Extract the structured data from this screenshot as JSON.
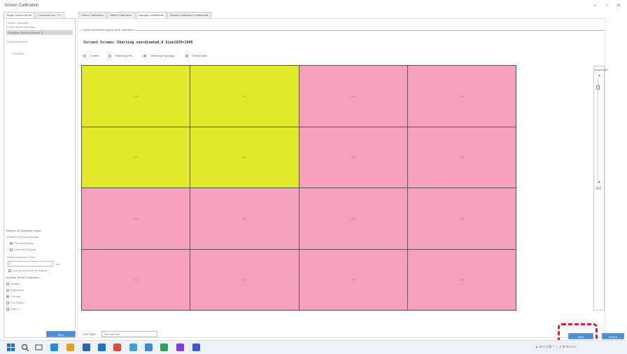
{
  "window": {
    "title": "Screen Calibration",
    "min": "–",
    "max": "▫",
    "close": "×"
  },
  "tabs_left": [
    "Single Screen Mode",
    "Combined Inc. T.C."
  ],
  "tabs_right": [
    "Online Calibration",
    "Offline Calibration",
    "Manage Coefficients",
    "Reload Calibration Coefficients"
  ],
  "left_panel": {
    "screen_section": "Current Operation",
    "sub_label": "Screen Mode Selection",
    "screen_item": "Configure Screen (Screen 1)",
    "receiver_label": "Current Receiver",
    "tree_item": "+ Screen1",
    "settings_title": "Settings of Displaying Image",
    "position_label": "Position to Display Image:",
    "opt_primary": "Primary Display",
    "opt_extended": "Extended Display",
    "delay_label": "Select Response Time:",
    "delay_value": "0",
    "delay_unit": "ms",
    "use_input": "Use input source for display",
    "gradient_title": "Gradient Border Calibration",
    "opt_disable": "Disable",
    "opt_brightness": "Brightness",
    "opt_chroma": "Chroma",
    "full_output": "Full Output",
    "data_in": "Data In"
  },
  "main": {
    "group_label": "Select coefficient regions to be operated",
    "info": "Current Screen: Starting coordinate0,0  Size1920×1080",
    "opt_screen": "Screen",
    "opt_file": "Select by File...",
    "opt_topology": "Select by Topology...",
    "opt_all": "Select Area",
    "cells": [
      "1-1",
      "1-2",
      "1-3",
      "1-4",
      "2-1",
      "2-2",
      "2-3",
      "2-4",
      "3-1",
      "3-2",
      "3-3",
      "3-4",
      "4-1",
      "4-2",
      "4-3",
      "4-4"
    ],
    "cell_types": [
      "y",
      "y",
      "p",
      "p",
      "y",
      "y",
      "p",
      "p",
      "p",
      "p",
      "p",
      "p",
      "p",
      "p",
      "p",
      "p"
    ],
    "right_title": "Brightness",
    "right_value": "4.7"
  },
  "bottom": {
    "save": "Save",
    "conf_label": "Conf Type:",
    "conf_value": "Normal Conf",
    "start": "Start",
    "finish": "Return"
  },
  "colors": {
    "yellow": "#e2e82a",
    "pink": "#f5a0bd",
    "accent": "#4a90d9",
    "highlight": "#e02020"
  },
  "taskbar": {
    "tray": "▲ 29°C 小雨  ⌃  ⚐  ⊿  ⊕ 中  17:17",
    "icons": [
      "windows-icon",
      "search-icon",
      "taskview-icon",
      "edge-icon",
      "files-icon",
      "store-icon",
      "mail-icon",
      "chrome-icon",
      "app-icon",
      "settings-icon",
      "app2-icon",
      "app3-icon",
      "app4-icon"
    ]
  }
}
